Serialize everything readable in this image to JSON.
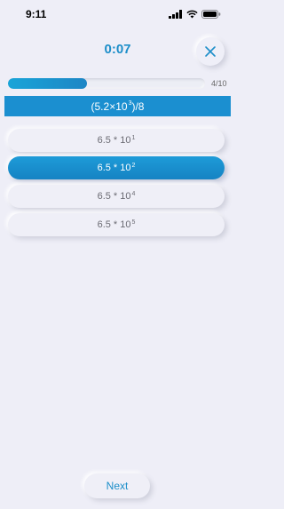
{
  "status_bar": {
    "time": "9:11"
  },
  "header": {
    "timer": "0:07"
  },
  "progress": {
    "text": "4/10",
    "fraction": 0.4
  },
  "question": {
    "prefix": "(5.2×10",
    "exp": "3",
    "suffix": ")/8"
  },
  "options": [
    {
      "base": "6.5 * 10",
      "exp": "1",
      "selected": false
    },
    {
      "base": "6.5 * 10",
      "exp": "2",
      "selected": true
    },
    {
      "base": "6.5 * 10",
      "exp": "4",
      "selected": false
    },
    {
      "base": "6.5 * 10",
      "exp": "5",
      "selected": false
    }
  ],
  "footer": {
    "next_label": "Next"
  },
  "colors": {
    "accent": "#1c8ec9",
    "background": "#eeeef7"
  },
  "icons": {
    "close": "close-icon",
    "wifi": "wifi-icon",
    "battery": "battery-icon",
    "signal": "signal-icon"
  }
}
